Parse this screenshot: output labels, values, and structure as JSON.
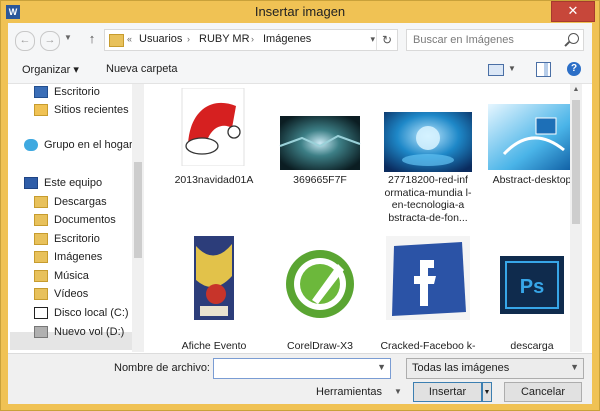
{
  "window": {
    "title": "Insertar imagen",
    "app_icon": "W",
    "close_glyph": "✕"
  },
  "nav": {
    "back": "←",
    "forward": "→",
    "up": "↑",
    "refresh": "↻"
  },
  "address": {
    "prefix": "«",
    "crumbs": [
      "Usuarios",
      "RUBY MR",
      "Imágenes"
    ],
    "separator": "›"
  },
  "search": {
    "placeholder": "Buscar en Imágenes"
  },
  "toolbar": {
    "organize": "Organizar ▾",
    "new_folder": "Nueva carpeta",
    "help": "?"
  },
  "sidebar": {
    "items": [
      {
        "label": "Escritorio",
        "icon": "desktop-icon"
      },
      {
        "label": "Sitios recientes",
        "icon": "recent-places-icon"
      },
      {
        "label": "Grupo en el hogar",
        "icon": "homegroup-icon"
      },
      {
        "label": "Este equipo",
        "icon": "this-pc-icon"
      },
      {
        "label": "Descargas",
        "icon": "folder-icon"
      },
      {
        "label": "Documentos",
        "icon": "folder-icon"
      },
      {
        "label": "Escritorio",
        "icon": "folder-icon"
      },
      {
        "label": "Imágenes",
        "icon": "folder-icon"
      },
      {
        "label": "Música",
        "icon": "music-folder-icon"
      },
      {
        "label": "Vídeos",
        "icon": "folder-icon"
      },
      {
        "label": "Disco local (C:)",
        "icon": "local-disk-icon"
      },
      {
        "label": "Nuevo vol (D:)",
        "icon": "volume-icon"
      }
    ]
  },
  "files": [
    {
      "name": "2013navidad01A"
    },
    {
      "name": "369665F7F"
    },
    {
      "name": "27718200-red-inf ormatica-mundia l-en-tecnologia-a bstracta-de-fon..."
    },
    {
      "name": "Abstract-desktop"
    },
    {
      "name": "Afiche Evento Colombia"
    },
    {
      "name": "CorelDraw-X3"
    },
    {
      "name": "Cracked-Faceboo k-Logo"
    },
    {
      "name": "descarga"
    }
  ],
  "footer": {
    "filename_label": "Nombre de archivo:",
    "filename_value": "",
    "filter_value": "Todas las imágenes",
    "tools_label": "Herramientas",
    "insert_label": "Insertar",
    "cancel_label": "Cancelar"
  },
  "colors": {
    "title_bar": "#f0c254",
    "close_button": "#c7473a",
    "accent": "#3c7fb1"
  }
}
